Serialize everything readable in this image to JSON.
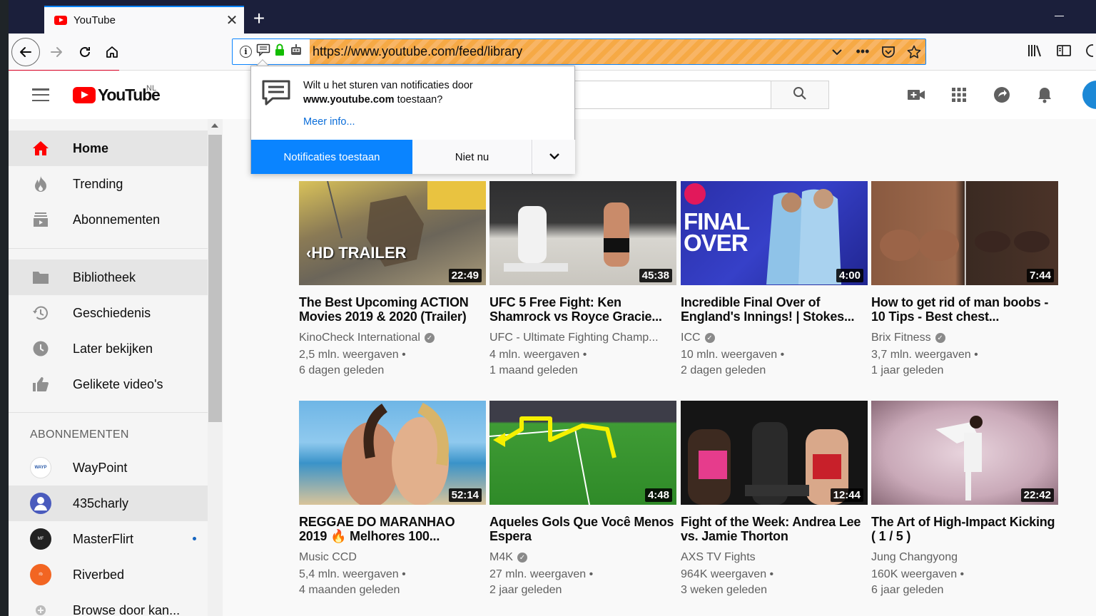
{
  "browser": {
    "tab_title": "YouTube",
    "url": "https://www.youtube.com/feed/library"
  },
  "popup": {
    "message_line1": "Wilt u het sturen van notificaties door",
    "message_domain": "www.youtube.com",
    "message_rest": " toestaan?",
    "more_info": "Meer info...",
    "allow_label": "Notificaties toestaan",
    "not_now_label": "Niet nu"
  },
  "masthead": {
    "logo_text": "YouTube",
    "country_code": "NL"
  },
  "sidebar": {
    "items": [
      {
        "label": "Home",
        "icon": "home-icon"
      },
      {
        "label": "Trending",
        "icon": "flame-icon"
      },
      {
        "label": "Abonnementen",
        "icon": "subscriptions-icon"
      },
      {
        "label": "Bibliotheek",
        "icon": "folder-icon"
      },
      {
        "label": "Geschiedenis",
        "icon": "history-icon"
      },
      {
        "label": "Later bekijken",
        "icon": "clock-icon"
      },
      {
        "label": "Gelikete video's",
        "icon": "thumbs-up-icon"
      }
    ],
    "subscriptions_heading": "ABONNEMENTEN",
    "subscriptions": [
      {
        "label": "WayPoint"
      },
      {
        "label": "435charly"
      },
      {
        "label": "MasterFlirt"
      },
      {
        "label": "Riverbed"
      },
      {
        "label": "Browse door kan..."
      }
    ]
  },
  "videos": [
    {
      "title": "The Best Upcoming ACTION Movies 2019 & 2020 (Trailer)",
      "channel": "KinoCheck International",
      "verified": true,
      "views": "2,5 mln. weergaven •",
      "age": "6 dagen geleden",
      "duration": "22:49",
      "thumb_text": "‹HD TRAILER"
    },
    {
      "title": "UFC 5 Free Fight: Ken Shamrock vs Royce Gracie...",
      "channel": "UFC - Ultimate Fighting Champ...",
      "verified": false,
      "views": "4 mln. weergaven •",
      "age": "1 maand geleden",
      "duration": "45:38",
      "thumb_text": ""
    },
    {
      "title": "Incredible Final Over of England's Innings! | Stokes...",
      "channel": "ICC",
      "verified": true,
      "views": "10 mln. weergaven •",
      "age": "2 dagen geleden",
      "duration": "4:00",
      "thumb_text": "FINAL OVER"
    },
    {
      "title": "How to get rid of man boobs - 10 Tips - Best chest...",
      "channel": "Brix Fitness",
      "verified": true,
      "views": "3,7 mln. weergaven •",
      "age": "1 jaar geleden",
      "duration": "7:44",
      "thumb_text": ""
    },
    {
      "title": "REGGAE DO MARANHAO 2019 🔥 Melhores 100...",
      "channel": "Music CCD",
      "verified": false,
      "views": "5,4 mln. weergaven •",
      "age": "4 maanden geleden",
      "duration": "52:14",
      "thumb_text": ""
    },
    {
      "title": "Aqueles Gols Que Você Menos Espera",
      "channel": "M4K",
      "verified": true,
      "views": "27 mln. weergaven •",
      "age": "2 jaar geleden",
      "duration": "4:48",
      "thumb_text": ""
    },
    {
      "title": "Fight of the Week: Andrea Lee vs. Jamie Thorton",
      "channel": "AXS TV Fights",
      "verified": false,
      "views": "964K weergaven •",
      "age": "3 weken geleden",
      "duration": "12:44",
      "thumb_text": ""
    },
    {
      "title": "The Art of High-Impact Kicking ( 1 / 5 )",
      "channel": "Jung Changyong",
      "verified": false,
      "views": "160K weergaven •",
      "age": "6 jaar geleden",
      "duration": "22:42",
      "thumb_text": ""
    }
  ],
  "colors": {
    "youtube_red": "#ff0000",
    "firefox_blue": "#0a84ff",
    "urlbar_orange": "#f6a945"
  }
}
